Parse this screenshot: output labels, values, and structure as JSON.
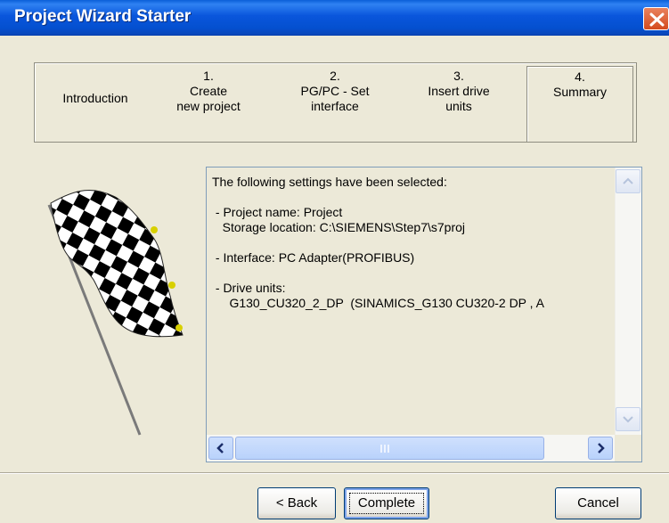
{
  "window": {
    "title": "Project Wizard Starter"
  },
  "steps": [
    {
      "number": "",
      "label": "Introduction"
    },
    {
      "number": "1.",
      "label": "Create\nnew project"
    },
    {
      "number": "2.",
      "label": "PG/PC - Set\ninterface"
    },
    {
      "number": "3.",
      "label": "Insert drive\nunits"
    },
    {
      "number": "4.",
      "label": "Summary"
    }
  ],
  "summary": {
    "text": "The following settings have been selected:\n\n - Project name: Project\n   Storage location: C:\\SIEMENS\\Step7\\s7proj\n\n - Interface: PC Adapter(PROFIBUS)\n\n - Drive units:\n     G130_CU320_2_DP  (SINAMICS_G130 CU320-2 DP , A"
  },
  "buttons": {
    "back": "< Back",
    "complete": "Complete",
    "cancel": "Cancel"
  },
  "icons": {
    "close": "close-icon",
    "flag": "checkered-flag-icon",
    "scroll_up": "scroll-up-icon",
    "scroll_down": "scroll-down-icon",
    "scroll_left": "scroll-left-icon",
    "scroll_right": "scroll-right-icon"
  },
  "colors": {
    "title_bar": "#0a56dc",
    "close_button": "#d44b1e",
    "dialog_background": "#ece9d8",
    "scroll_thumb": "#b9d2fb"
  }
}
